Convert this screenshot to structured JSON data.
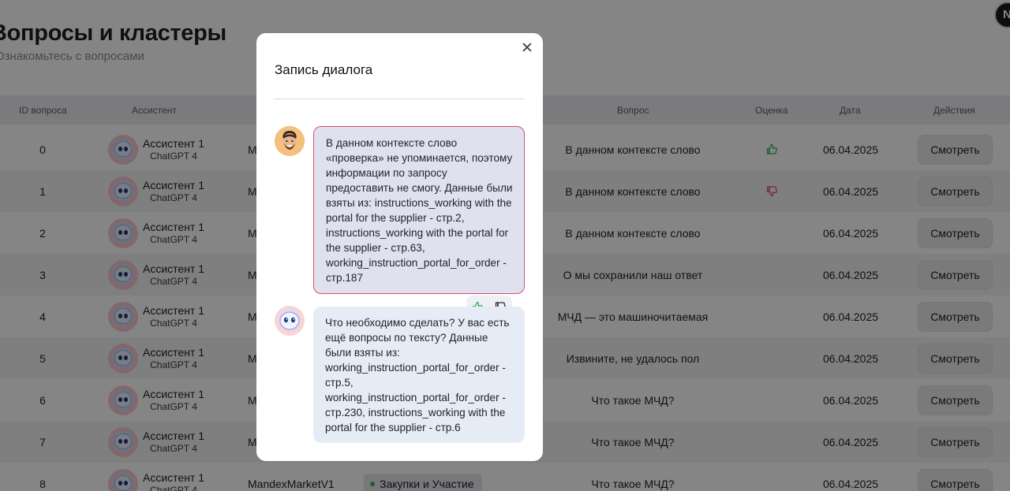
{
  "page": {
    "title": "Вопросы и кластеры",
    "subtitle": "Ознакомьтесь с вопросами",
    "user_initial": "N"
  },
  "table": {
    "headers": {
      "id": "ID вопроса",
      "assistant": "Ассистент",
      "question": "Вопрос",
      "rating": "Оценка",
      "date": "Дата",
      "actions": "Действия"
    },
    "rows": [
      {
        "id": "0",
        "assistant": "Ассистент 1",
        "model": "ChatGPT 4",
        "bot": "M",
        "tag": "",
        "question": "В данном контексте слово",
        "rating": "up",
        "date": "06.04.2025",
        "action": "Смотреть"
      },
      {
        "id": "1",
        "assistant": "Ассистент 1",
        "model": "ChatGPT 4",
        "bot": "M",
        "tag": "",
        "question": "В данном контексте слово",
        "rating": "down",
        "date": "06.04.2025",
        "action": "Смотреть"
      },
      {
        "id": "2",
        "assistant": "Ассистент 1",
        "model": "ChatGPT 4",
        "bot": "M",
        "tag": "",
        "question": "В данном контексте слово",
        "rating": "",
        "date": "06.04.2025",
        "action": "Смотреть"
      },
      {
        "id": "3",
        "assistant": "Ассистент 1",
        "model": "ChatGPT 4",
        "bot": "M",
        "tag": "",
        "question": "О мы сохранили наш ответ",
        "rating": "",
        "date": "06.04.2025",
        "action": "Смотреть"
      },
      {
        "id": "4",
        "assistant": "Ассистент 1",
        "model": "ChatGPT 4",
        "bot": "M",
        "tag": "",
        "question": "МЧД — это машиночитаемая",
        "rating": "",
        "date": "06.04.2025",
        "action": "Смотреть"
      },
      {
        "id": "5",
        "assistant": "Ассистент 1",
        "model": "ChatGPT 4",
        "bot": "M",
        "tag": "",
        "question": "Извините, не удалось пол",
        "rating": "",
        "date": "06.04.2025",
        "action": "Смотреть"
      },
      {
        "id": "6",
        "assistant": "Ассистент 1",
        "model": "ChatGPT 4",
        "bot": "M",
        "tag": "",
        "question": "Что такое МЧД?",
        "rating": "",
        "date": "06.04.2025",
        "action": "Смотреть"
      },
      {
        "id": "7",
        "assistant": "Ассистент 1",
        "model": "ChatGPT 4",
        "bot": "M",
        "tag": "",
        "question": "Что такое МЧД?",
        "rating": "",
        "date": "06.04.2025",
        "action": "Смотреть"
      },
      {
        "id": "8",
        "assistant": "Ассистент 1",
        "model": "ChatGPT 4",
        "bot": "MandexMarketV1",
        "tag": "Закупки и Участие",
        "question": "Что такое МЧД?",
        "rating": "",
        "date": "06.04.2025",
        "action": "Смотреть"
      }
    ]
  },
  "modal": {
    "title": "Запись диалога",
    "user_message": "В данном контексте слово «проверка» не упоминается, поэтому информации по запросу предоставить не смогу. Данные были взяты из: instructions_working with the portal for the supplier - стр.2, instructions_working with the portal for the supplier - стр.63, working_instruction_portal_for_order - стр.187",
    "bot_message": "Что необходимо сделать? У вас есть ещё вопросы по тексту? Данные были взяты из: working_instruction_portal_for_order - стр.5, working_instruction_portal_for_order - стр.230, instructions_working with the portal for the supplier - стр.6"
  },
  "colors": {
    "like": "#2db84d",
    "dislike": "#e04a73",
    "user_bubble_border": "#e04a73"
  }
}
